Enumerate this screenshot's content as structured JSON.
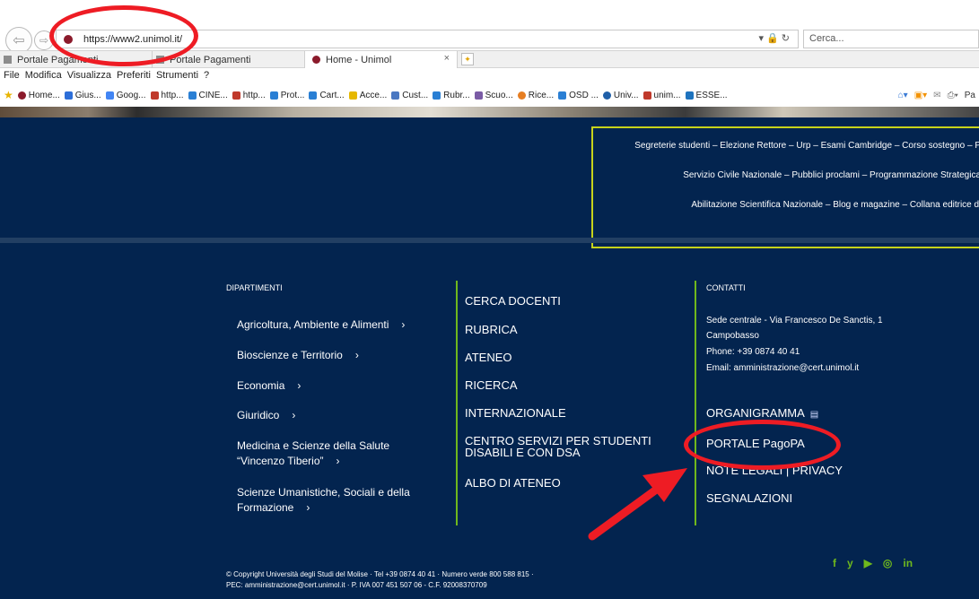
{
  "browser": {
    "url": "https://www2.unimol.it/",
    "search_placeholder": "Cerca...",
    "tabs": [
      {
        "label": "Portale Pagamenti",
        "active": false
      },
      {
        "label": "Portale Pagamenti",
        "active": false
      },
      {
        "label": "Home - Unimol",
        "active": true
      }
    ],
    "tab_close": "×",
    "menu": [
      "File",
      "Modifica",
      "Visualizza",
      "Preferiti",
      "Strumenti",
      "?"
    ],
    "favorites": [
      "Home...",
      "Gius...",
      "Goog...",
      "http...",
      "CINE...",
      "http...",
      "Prot...",
      "Cart...",
      "Acce...",
      "Cust...",
      "Rubr...",
      "Scuo...",
      "Rice...",
      "OSD ...",
      "Univ...",
      "unim...",
      "ESSE..."
    ],
    "fav_right_partial": "Pa",
    "icons": {
      "back": "back-arrow-icon",
      "forward": "forward-arrow-icon",
      "lock": "lock-icon",
      "refresh": "refresh-icon"
    }
  },
  "quicklinks": [
    "Segreterie studenti – Elezione Rettore – Urp  – Esami Cambridge – Corso sostegno – P",
    "Servizio Civile Nazionale – Pubblici proclami – Programmazione Strategica",
    "Abilitazione Scientifica Nazionale – Blog e magazine – Collana editrice d'"
  ],
  "footer": {
    "dipartimenti_heading": "DIPARTIMENTI",
    "departments": [
      {
        "line1": "Agricoltura, Ambiente e Alimenti",
        "line2": ""
      },
      {
        "line1": "Bioscienze e Territorio",
        "line2": ""
      },
      {
        "line1": "Economia",
        "line2": ""
      },
      {
        "line1": "Giuridico",
        "line2": ""
      },
      {
        "line1": "Medicina e Scienze della Salute",
        "line2": "“Vincenzo Tiberio”"
      },
      {
        "line1": "Scienze Umanistiche, Sociali e della",
        "line2": "Formazione"
      }
    ],
    "chevron": "›",
    "links": [
      {
        "line1": "CERCA DOCENTI",
        "line2": ""
      },
      {
        "line1": "RUBRICA",
        "line2": ""
      },
      {
        "line1": "ATENEO",
        "line2": ""
      },
      {
        "line1": "RICERCA",
        "line2": ""
      },
      {
        "line1": "INTERNAZIONALE",
        "line2": ""
      },
      {
        "line1": "CENTRO SERVIZI PER STUDENTI",
        "line2": "DISABILI E CON DSA"
      },
      {
        "line1": "ALBO DI ATENEO",
        "line2": ""
      }
    ],
    "contatti_heading": "CONTATTI",
    "contacts": [
      "Sede centrale - Via Francesco De Sanctis, 1",
      "Campobasso",
      "Phone: +39 0874 40 41",
      "Email: amministrazione@cert.unimol.it"
    ],
    "contact_links": [
      "ORGANIGRAMMA",
      "PORTALE PagoPA",
      "NOTE LEGALI | PRIVACY",
      "SEGNALAZIONI"
    ],
    "copyright_line1": "© Copyright Università degli Studi del Molise · Tel +39 0874 40 41 · Numero verde 800 588 815 ·",
    "copyright_line2": "PEC: amministrazione@cert.unimol.it · P. IVA 007 451 507 06 - C.F. 92008370709",
    "socials": [
      "f",
      "y",
      "▶",
      "◎",
      "in"
    ]
  },
  "colors": {
    "page_bg": "#03244f",
    "accent_green": "#6fb81d",
    "quicklinks_border": "#c7d31b",
    "annotation_red": "#ee1c24"
  }
}
